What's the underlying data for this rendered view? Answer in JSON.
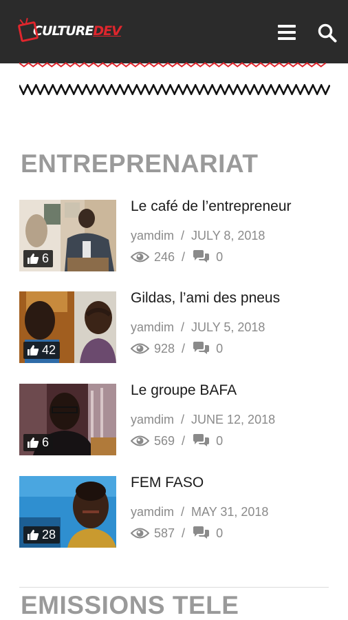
{
  "header": {
    "logo_culture": "CULTURE",
    "logo_dev": "DEV",
    "menu_icon": "hamburger-menu-icon",
    "search_icon": "search-icon",
    "bg_color": "#2b2b2b",
    "accent_color": "#e0262d"
  },
  "sections": [
    {
      "title": "ENTREPRENARIAT"
    },
    {
      "title": "EMISSIONS TELE"
    }
  ],
  "posts": [
    {
      "title": "Le café de l’entrepreneur",
      "author": "yamdim",
      "date": "JULY 8, 2018",
      "views": "246",
      "comments": "0",
      "likes": "6"
    },
    {
      "title": "Gildas, l’ami des pneus",
      "author": "yamdim",
      "date": "JULY 5, 2018",
      "views": "928",
      "comments": "0",
      "likes": "42"
    },
    {
      "title": "Le groupe BAFA",
      "author": "yamdim",
      "date": "JUNE 12, 2018",
      "views": "569",
      "comments": "0",
      "likes": "6"
    },
    {
      "title": "FEM FASO",
      "author": "yamdim",
      "date": "MAY 31, 2018",
      "views": "587",
      "comments": "0",
      "likes": "28"
    }
  ],
  "meta_separator": "/"
}
